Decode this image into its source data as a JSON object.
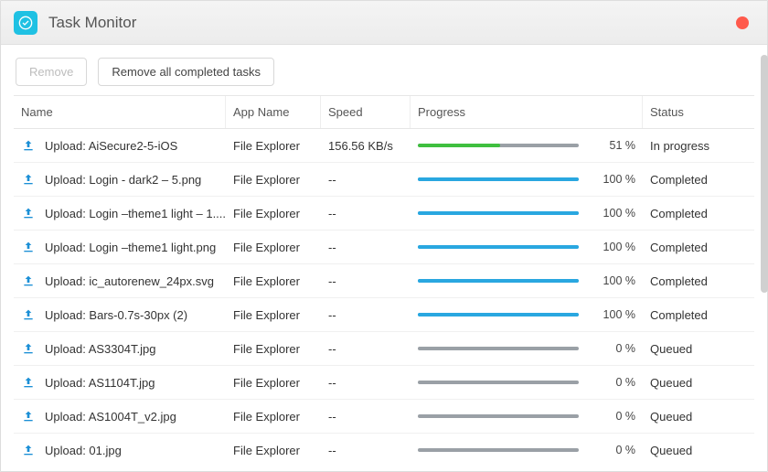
{
  "window": {
    "title": "Task Monitor"
  },
  "toolbar": {
    "remove_label": "Remove",
    "remove_all_label": "Remove all completed tasks"
  },
  "columns": {
    "name": "Name",
    "app_name": "App Name",
    "speed": "Speed",
    "progress": "Progress",
    "status": "Status"
  },
  "colors": {
    "progress_green": "#3fbf3f",
    "progress_blue": "#29a7e0",
    "progress_gray": "#9aa0a6"
  },
  "tasks": [
    {
      "name": "Upload: AiSecure2-5-iOS",
      "app": "File Explorer",
      "speed": "156.56 KB/s",
      "percent": 51,
      "percent_label": "51 %",
      "status": "In progress",
      "bar_color": "progress_green",
      "track_color": "progress_gray"
    },
    {
      "name": "Upload: Login - dark2 – 5.png",
      "app": "File Explorer",
      "speed": "--",
      "percent": 100,
      "percent_label": "100 %",
      "status": "Completed",
      "bar_color": "progress_blue",
      "track_color": "progress_blue"
    },
    {
      "name": "Upload: Login –theme1 light – 1....",
      "app": "File Explorer",
      "speed": "--",
      "percent": 100,
      "percent_label": "100 %",
      "status": "Completed",
      "bar_color": "progress_blue",
      "track_color": "progress_blue"
    },
    {
      "name": "Upload: Login –theme1 light.png",
      "app": "File Explorer",
      "speed": "--",
      "percent": 100,
      "percent_label": "100 %",
      "status": "Completed",
      "bar_color": "progress_blue",
      "track_color": "progress_blue"
    },
    {
      "name": "Upload: ic_autorenew_24px.svg",
      "app": "File Explorer",
      "speed": "--",
      "percent": 100,
      "percent_label": "100 %",
      "status": "Completed",
      "bar_color": "progress_blue",
      "track_color": "progress_blue"
    },
    {
      "name": "Upload: Bars-0.7s-30px (2)",
      "app": "File Explorer",
      "speed": "--",
      "percent": 100,
      "percent_label": "100 %",
      "status": "Completed",
      "bar_color": "progress_blue",
      "track_color": "progress_blue"
    },
    {
      "name": "Upload: AS3304T.jpg",
      "app": "File Explorer",
      "speed": "--",
      "percent": 0,
      "percent_label": "0 %",
      "status": "Queued",
      "bar_color": "progress_gray",
      "track_color": "progress_gray"
    },
    {
      "name": "Upload: AS1104T.jpg",
      "app": "File Explorer",
      "speed": "--",
      "percent": 0,
      "percent_label": "0 %",
      "status": "Queued",
      "bar_color": "progress_gray",
      "track_color": "progress_gray"
    },
    {
      "name": "Upload: AS1004T_v2.jpg",
      "app": "File Explorer",
      "speed": "--",
      "percent": 0,
      "percent_label": "0 %",
      "status": "Queued",
      "bar_color": "progress_gray",
      "track_color": "progress_gray"
    },
    {
      "name": "Upload: 01.jpg",
      "app": "File Explorer",
      "speed": "--",
      "percent": 0,
      "percent_label": "0 %",
      "status": "Queued",
      "bar_color": "progress_gray",
      "track_color": "progress_gray"
    }
  ]
}
